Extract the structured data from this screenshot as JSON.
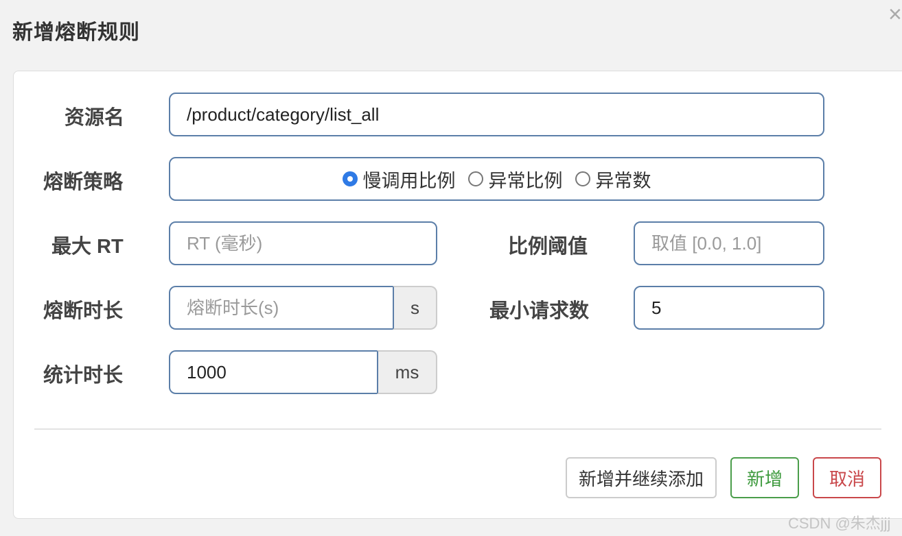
{
  "dialog": {
    "title": "新增熔断规则",
    "close_icon": "close-icon"
  },
  "form": {
    "resource": {
      "label": "资源名",
      "value": "/product/category/list_all",
      "placeholder": ""
    },
    "strategy": {
      "label": "熔断策略",
      "options": [
        {
          "label": "慢调用比例",
          "checked": true
        },
        {
          "label": "异常比例",
          "checked": false
        },
        {
          "label": "异常数",
          "checked": false
        }
      ]
    },
    "max_rt": {
      "label": "最大 RT",
      "value": "",
      "placeholder": "RT (毫秒)"
    },
    "ratio_threshold": {
      "label": "比例阈值",
      "value": "",
      "placeholder": "取值 [0.0, 1.0]"
    },
    "break_duration": {
      "label": "熔断时长",
      "value": "",
      "placeholder": "熔断时长(s)",
      "unit": "s"
    },
    "min_requests": {
      "label": "最小请求数",
      "value": "5",
      "placeholder": ""
    },
    "stat_duration": {
      "label": "统计时长",
      "value": "1000",
      "placeholder": "",
      "unit": "ms"
    }
  },
  "buttons": {
    "add_continue": "新增并继续添加",
    "add": "新增",
    "cancel": "取消"
  },
  "colors": {
    "input_border": "#5b7ea8",
    "radio_checked": "#2f7ae5",
    "success": "#3e9a3e",
    "danger": "#c9474a"
  },
  "watermark": "CSDN @朱杰jjj"
}
